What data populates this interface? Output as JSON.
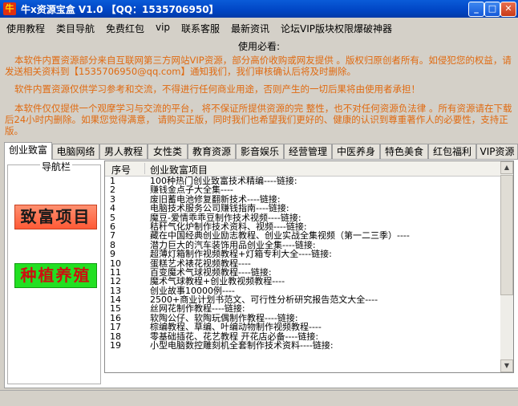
{
  "window": {
    "icon_char": "牛",
    "title": "牛x资源宝盒 V1.0 【QQ：1535706950】",
    "minimize_glyph": "_",
    "maximize_glyph": "□",
    "close_glyph": "✕"
  },
  "menu": [
    "使用教程",
    "类目导航",
    "免费红包",
    "vip",
    "联系客服",
    "最新资讯",
    "论坛VIP版块权限爆破神器"
  ],
  "notice": {
    "title": "使用必看:",
    "para1": "本软件内置资源部分来自互联网第三方网站VIP资源，部分高价收购或网友提供 。版权归原创者所有。如侵犯您的权益，请发送相关资料到【1535706950@qq.com】通知我们，我们审核确认后将及时删除。",
    "para2": "软件内置资源仅供学习参考和交流，不得进行任何商业用途，否则产生的一切后果将由使用者承担！",
    "para3": "本软件仅仅提供一个观摩学习与交流的平台，  将不保证所提供资源的完 整性，也不对任何资源负法律 。所有资源请在下载后24小时内删除。如果您觉得满意，  请购买正版，同时我们也希望我们更好的、健康的认识到尊重著作人的必要性，支持正版。"
  },
  "tabs": [
    "创业致富",
    "电脑网络",
    "男人教程",
    "女性类",
    "教育资源",
    "影音娱乐",
    "经营管理",
    "中医养身",
    "特色美食",
    "红包福利",
    "VIP资源"
  ],
  "nav": {
    "label": "导航栏",
    "btn1": "致富项目",
    "btn2": "种植养殖"
  },
  "list": {
    "col_no": "序号",
    "col_name": "创业致富项目",
    "rows": [
      {
        "no": "1",
        "name": "100种热门创业致富技术精编----链接:"
      },
      {
        "no": "2",
        "name": "赚钱金点子大全集----"
      },
      {
        "no": "3",
        "name": "废旧蓄电池修复翻新技术----链接:"
      },
      {
        "no": "4",
        "name": "电脑技术服务公司赚钱指南----链接:"
      },
      {
        "no": "5",
        "name": "魔豆-爱情乖乖豆制作技术视频----链接:"
      },
      {
        "no": "6",
        "name": "秸秆气化炉制作技术资料、视频----链接:"
      },
      {
        "no": "7",
        "name": "藏在中国经典创业励志教程、创业实战全集视频（第一二三季）----"
      },
      {
        "no": "8",
        "name": "潜力巨大的汽车装饰用品创业全集----链接:"
      },
      {
        "no": "9",
        "name": "超薄灯箱制作视频教程+灯箱专利大全----链接:"
      },
      {
        "no": "10",
        "name": "蛋糕艺术裱花视频教程----"
      },
      {
        "no": "11",
        "name": "百变魔术气球视频教程----链接:"
      },
      {
        "no": "12",
        "name": "魔术气球教程+创业教视频教程----"
      },
      {
        "no": "13",
        "name": "创业故事10000例----"
      },
      {
        "no": "14",
        "name": "2500+商业计划书范文、可行性分析研究报告范文大全----"
      },
      {
        "no": "15",
        "name": "丝网花制作教程----链接:"
      },
      {
        "no": "16",
        "name": "软陶公仔、软陶玩偶制作教程----链接:"
      },
      {
        "no": "17",
        "name": "棕编教程、草编、叶编动物制作视频教程----"
      },
      {
        "no": "18",
        "name": "零基础插花、花艺教程 开花店必备----链接:"
      },
      {
        "no": "19",
        "name": "小型电脑数控雕刻机全套制作技术资料----链接:"
      }
    ]
  },
  "colors": {
    "notice": "#e06a10",
    "title_bar": "#0a5bd8",
    "nav1_bg": "#ff6a45",
    "nav2_bg": "#22e022",
    "nav2_text": "#cc1010"
  }
}
